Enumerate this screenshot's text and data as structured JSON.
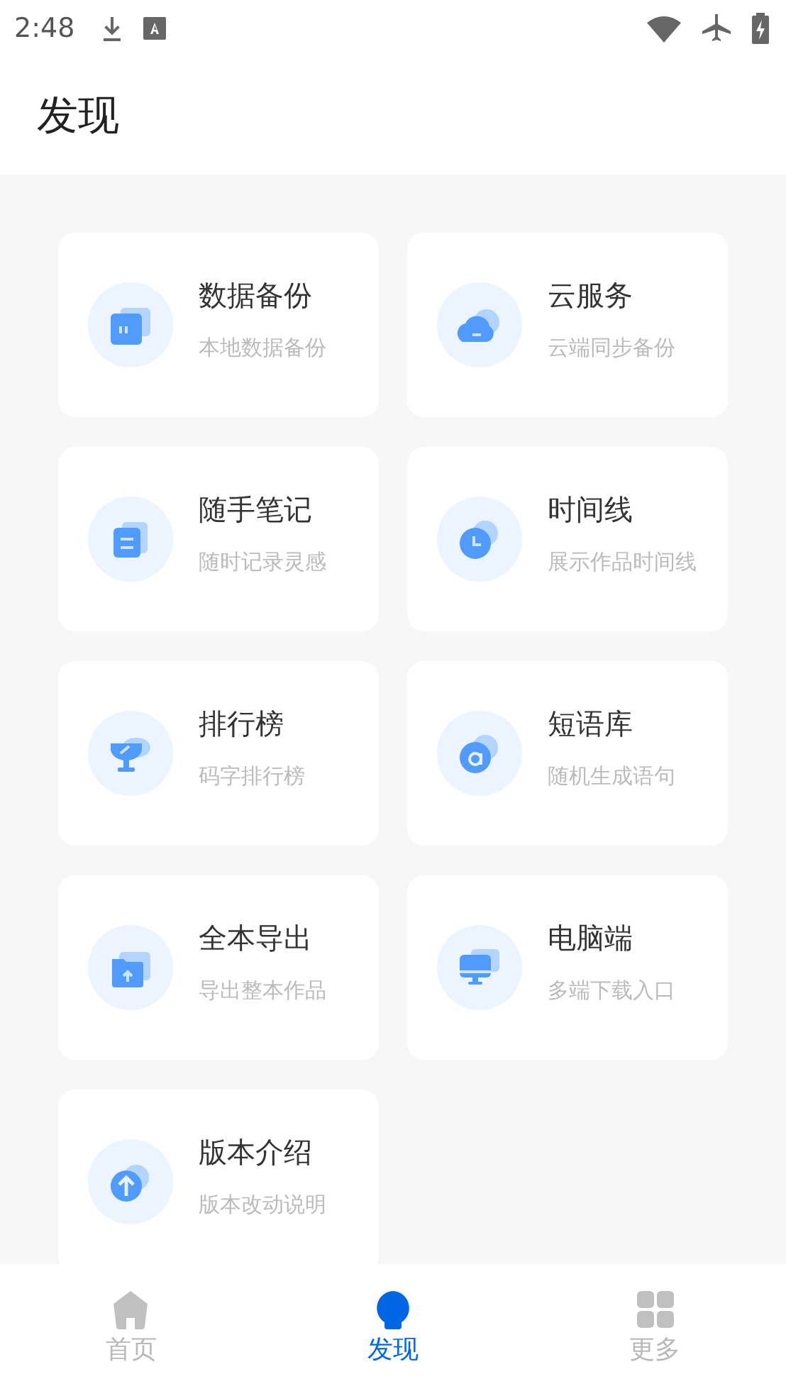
{
  "status_bar": {
    "time": "2:48"
  },
  "header": {
    "title": "发现"
  },
  "cards": [
    {
      "kind": "files",
      "title": "数据备份",
      "subtitle": "本地数据备份"
    },
    {
      "kind": "cloud",
      "title": "云服务",
      "subtitle": "云端同步备份"
    },
    {
      "kind": "note",
      "title": "随手笔记",
      "subtitle": "随时记录灵感"
    },
    {
      "kind": "clock",
      "title": "时间线",
      "subtitle": "展示作品时间线"
    },
    {
      "kind": "trophy",
      "title": "排行榜",
      "subtitle": "码字排行榜"
    },
    {
      "kind": "letter",
      "title": "短语库",
      "subtitle": "随机生成语句"
    },
    {
      "kind": "folder",
      "title": "全本导出",
      "subtitle": "导出整本作品"
    },
    {
      "kind": "monitor",
      "title": "电脑端",
      "subtitle": "多端下载入口"
    },
    {
      "kind": "upload",
      "title": "版本介绍",
      "subtitle": "版本改动说明"
    }
  ],
  "bottom_nav": [
    {
      "kind": "home",
      "label": "首页",
      "selected": false
    },
    {
      "kind": "bulb",
      "label": "发现",
      "selected": true
    },
    {
      "kind": "grid",
      "label": "更多",
      "selected": false
    }
  ]
}
